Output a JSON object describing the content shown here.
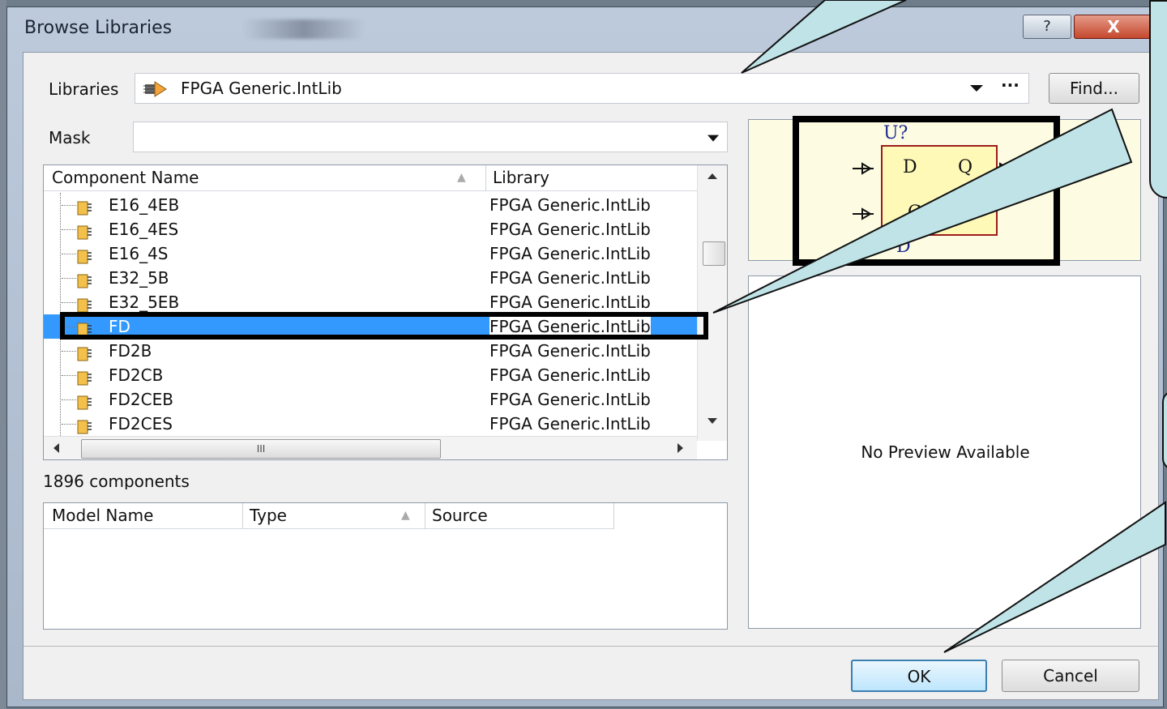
{
  "window": {
    "title": "Browse Libraries",
    "help_label": "?",
    "close_label": "X"
  },
  "libraries": {
    "label": "Libraries",
    "value": "FPGA Generic.IntLib",
    "more_label": "···",
    "find_label": "Find..."
  },
  "mask": {
    "label": "Mask",
    "value": ""
  },
  "component_grid": {
    "headers": {
      "name": "Component Name",
      "library": "Library"
    },
    "rows": [
      {
        "name": "E16_4EB",
        "library": "FPGA Generic.IntLib"
      },
      {
        "name": "E16_4ES",
        "library": "FPGA Generic.IntLib"
      },
      {
        "name": "E16_4S",
        "library": "FPGA Generic.IntLib"
      },
      {
        "name": "E32_5B",
        "library": "FPGA Generic.IntLib"
      },
      {
        "name": "E32_5EB",
        "library": "FPGA Generic.IntLib"
      },
      {
        "name": "FD",
        "library": "FPGA Generic.IntLib"
      },
      {
        "name": "FD2B",
        "library": "FPGA Generic.IntLib"
      },
      {
        "name": "FD2CB",
        "library": "FPGA Generic.IntLib"
      },
      {
        "name": "FD2CEB",
        "library": "FPGA Generic.IntLib"
      },
      {
        "name": "FD2CES",
        "library": "FPGA Generic.IntLib"
      }
    ],
    "selected_index": 5,
    "hscroll_grip": "III"
  },
  "component_count": "1896 components",
  "model_grid": {
    "headers": {
      "name": "Model Name",
      "type": "Type",
      "source": "Source"
    }
  },
  "symbol_preview": {
    "designator": "U?",
    "pin_d": "D",
    "pin_q": "Q",
    "pin_c": "C",
    "pin_d_bottom": "D"
  },
  "model_preview": {
    "text": "No Preview Available"
  },
  "buttons": {
    "ok": "OK",
    "cancel": "Cancel"
  },
  "colors": {
    "selection": "#3399ff",
    "callout_fill": "#bfe3e6",
    "symbol_fill": "#fff9b8",
    "symbol_border": "#9b1d1d",
    "symbol_text": "#1d2a8c"
  }
}
